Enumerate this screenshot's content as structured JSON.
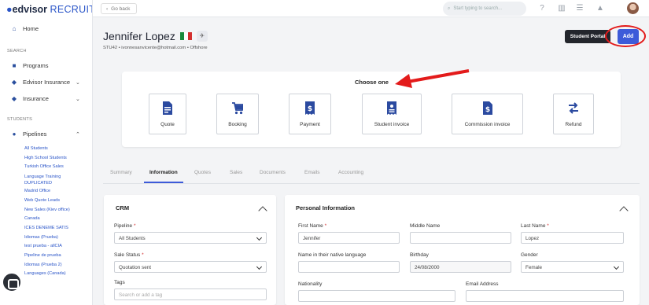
{
  "app": {
    "logo_bold": "edvisor",
    "logo_light": "RECRUIT"
  },
  "sidebar": {
    "home": "Home",
    "search_heading": "SEARCH",
    "programs": "Programs",
    "edvisor_insurance": "Edvisor Insurance",
    "insurance": "Insurance",
    "students_heading": "STUDENTS",
    "pipelines": "Pipelines",
    "pipeline_items": [
      "All Students",
      "High School Students",
      "Turkish Office Sales",
      "Language Training",
      "DUPLICATED",
      "Madrid Office",
      "Web Quote Leads",
      "New Sales (Kiev office)",
      "Canada",
      "ICES DENEME SATIS",
      "Idiomas (Prueba)",
      "test prueba - allCIA",
      "Pipeline de prueba",
      "Idiomas (Prueba 2)",
      "Languages (Canada)"
    ]
  },
  "topbar": {
    "go_back": "Go back",
    "search_placeholder": "Start typing to search..."
  },
  "student": {
    "name": "Jennifer Lopez",
    "subtitle": "STU42 • ivonnesanvicente@hotmail.com • Offshore"
  },
  "actions": {
    "student_portal": "Student Portal",
    "add": "Add"
  },
  "choose": {
    "title": "Choose one",
    "options": [
      "Quote",
      "Booking",
      "Payment",
      "Student invoice",
      "Commission invoice",
      "Refund"
    ]
  },
  "tabs": [
    "Summary",
    "Information",
    "Quotes",
    "Sales",
    "Documents",
    "Emails",
    "Accounting"
  ],
  "active_tab": "Information",
  "crm": {
    "title": "CRM",
    "pipeline_label": "Pipeline",
    "pipeline_value": "All Students",
    "sale_status_label": "Sale Status",
    "sale_status_value": "Quotation sent",
    "tags_label": "Tags",
    "tags_placeholder": "Search or add a tag"
  },
  "personal": {
    "title": "Personal Information",
    "first_name_label": "First Name",
    "first_name": "Jennifer",
    "middle_name_label": "Middle Name",
    "middle_name": "",
    "last_name_label": "Last Name",
    "last_name": "Lopez",
    "native_label": "Name in their native language",
    "native": "",
    "birthday_label": "Birthday",
    "birthday": "24/08/2000",
    "gender_label": "Gender",
    "gender": "Female",
    "nationality_label": "Nationality",
    "email_label": "Email Address"
  },
  "colors": {
    "accent": "#3d5bd9",
    "annotation": "#e31b1b"
  }
}
